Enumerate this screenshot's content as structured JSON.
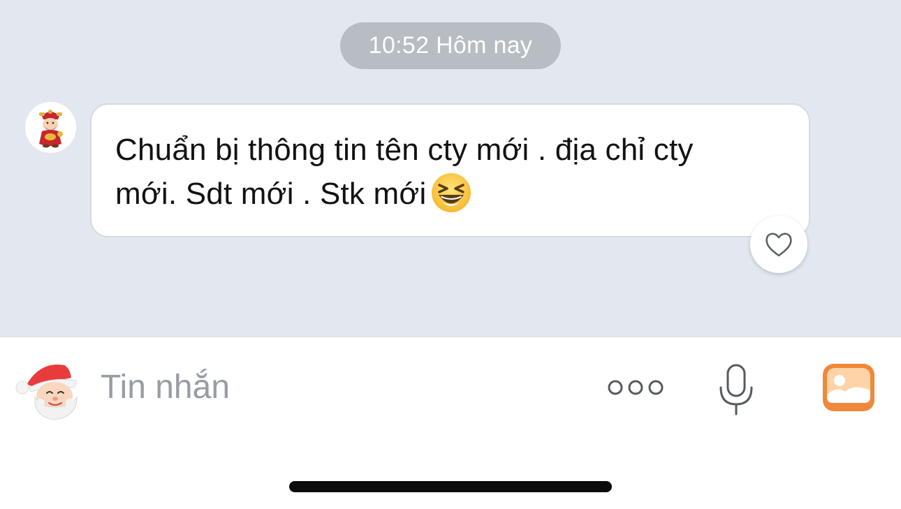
{
  "chat": {
    "timestamp": "10:52 Hôm nay",
    "messages": [
      {
        "lines": [
          "Chuẩn bị thông tin tên cty mới . địa chỉ cty",
          "mới. Sdt mới . Stk mới"
        ],
        "emoji": "laughing-squinting-face-icon",
        "reaction": "heart-icon"
      }
    ]
  },
  "composer": {
    "placeholder": "Tin nhắn",
    "sticker_icon": "santa-sticker-icon",
    "more_icon": "more-options-icon",
    "mic_icon": "microphone-icon",
    "photo_icon": "photo-gallery-icon"
  },
  "colors": {
    "chat_background": "#e3e7ef",
    "timestamp_pill": "#b8bcc3",
    "photo_accent": "#f0883a",
    "placeholder_text": "#989ca3"
  }
}
